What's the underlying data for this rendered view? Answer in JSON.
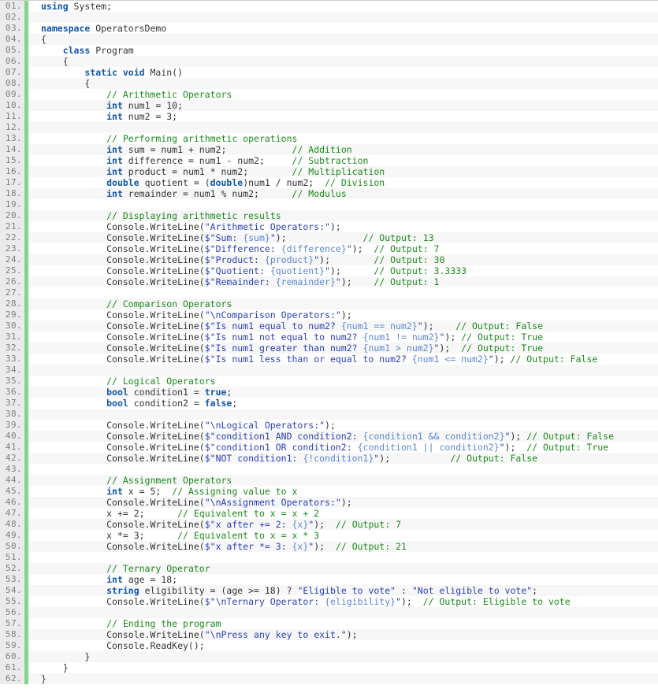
{
  "editor": {
    "language": "csharp",
    "total_lines": 62,
    "colors": {
      "keyword": "#1155aa",
      "comment": "#1a8a1a",
      "string": "#2a3fb8",
      "interpolation": "#5b86d6",
      "plain": "#333333",
      "gutter_bg": "#ebebeb",
      "gutter_text": "#808080",
      "gutter_bar": "#85d48a",
      "row_bg": "#ffffff",
      "row_alt_bg": "#f7f7f7"
    }
  },
  "lines": [
    {
      "n": "01.",
      "tokens": [
        {
          "t": "using",
          "c": "kw"
        },
        {
          "t": " System;",
          "c": "pl"
        }
      ]
    },
    {
      "n": "02.",
      "tokens": []
    },
    {
      "n": "03.",
      "tokens": [
        {
          "t": "namespace",
          "c": "kw"
        },
        {
          "t": " OperatorsDemo",
          "c": "pl"
        }
      ]
    },
    {
      "n": "04.",
      "tokens": [
        {
          "t": "{",
          "c": "pl"
        }
      ]
    },
    {
      "n": "05.",
      "tokens": [
        {
          "t": "    ",
          "c": "pl"
        },
        {
          "t": "class",
          "c": "kw"
        },
        {
          "t": " Program",
          "c": "pl"
        }
      ]
    },
    {
      "n": "06.",
      "tokens": [
        {
          "t": "    {",
          "c": "pl"
        }
      ]
    },
    {
      "n": "07.",
      "tokens": [
        {
          "t": "        ",
          "c": "pl"
        },
        {
          "t": "static",
          "c": "kw"
        },
        {
          "t": " ",
          "c": "pl"
        },
        {
          "t": "void",
          "c": "kw"
        },
        {
          "t": " Main()",
          "c": "pl"
        }
      ]
    },
    {
      "n": "08.",
      "tokens": [
        {
          "t": "        {",
          "c": "pl"
        }
      ]
    },
    {
      "n": "09.",
      "tokens": [
        {
          "t": "            ",
          "c": "pl"
        },
        {
          "t": "// Arithmetic Operators",
          "c": "cmt"
        }
      ]
    },
    {
      "n": "10.",
      "tokens": [
        {
          "t": "            ",
          "c": "pl"
        },
        {
          "t": "int",
          "c": "kw"
        },
        {
          "t": " num1 = 10;",
          "c": "pl"
        }
      ]
    },
    {
      "n": "11.",
      "tokens": [
        {
          "t": "            ",
          "c": "pl"
        },
        {
          "t": "int",
          "c": "kw"
        },
        {
          "t": " num2 = 3;",
          "c": "pl"
        }
      ]
    },
    {
      "n": "12.",
      "tokens": []
    },
    {
      "n": "13.",
      "tokens": [
        {
          "t": "            ",
          "c": "pl"
        },
        {
          "t": "// Performing arithmetic operations",
          "c": "cmt"
        }
      ]
    },
    {
      "n": "14.",
      "tokens": [
        {
          "t": "            ",
          "c": "pl"
        },
        {
          "t": "int",
          "c": "kw"
        },
        {
          "t": " sum = num1 + num2;            ",
          "c": "pl"
        },
        {
          "t": "// Addition",
          "c": "cmt"
        }
      ]
    },
    {
      "n": "15.",
      "tokens": [
        {
          "t": "            ",
          "c": "pl"
        },
        {
          "t": "int",
          "c": "kw"
        },
        {
          "t": " difference = num1 - num2;     ",
          "c": "pl"
        },
        {
          "t": "// Subtraction",
          "c": "cmt"
        }
      ]
    },
    {
      "n": "16.",
      "tokens": [
        {
          "t": "            ",
          "c": "pl"
        },
        {
          "t": "int",
          "c": "kw"
        },
        {
          "t": " product = num1 * num2;        ",
          "c": "pl"
        },
        {
          "t": "// Multiplication",
          "c": "cmt"
        }
      ]
    },
    {
      "n": "17.",
      "tokens": [
        {
          "t": "            ",
          "c": "pl"
        },
        {
          "t": "double",
          "c": "kw"
        },
        {
          "t": " quotient = (",
          "c": "pl"
        },
        {
          "t": "double",
          "c": "kw"
        },
        {
          "t": ")num1 / num2;  ",
          "c": "pl"
        },
        {
          "t": "// Division",
          "c": "cmt"
        }
      ]
    },
    {
      "n": "18.",
      "tokens": [
        {
          "t": "            ",
          "c": "pl"
        },
        {
          "t": "int",
          "c": "kw"
        },
        {
          "t": " remainder = num1 % num2;      ",
          "c": "pl"
        },
        {
          "t": "// Modulus",
          "c": "cmt"
        }
      ]
    },
    {
      "n": "19.",
      "tokens": []
    },
    {
      "n": "20.",
      "tokens": [
        {
          "t": "            ",
          "c": "pl"
        },
        {
          "t": "// Displaying arithmetic results",
          "c": "cmt"
        }
      ]
    },
    {
      "n": "21.",
      "tokens": [
        {
          "t": "            Console.WriteLine(",
          "c": "pl"
        },
        {
          "t": "\"Arithmetic Operators:\"",
          "c": "str"
        },
        {
          "t": ");",
          "c": "pl"
        }
      ]
    },
    {
      "n": "22.",
      "tokens": [
        {
          "t": "            Console.WriteLine(",
          "c": "pl"
        },
        {
          "t": "$\"Sum: ",
          "c": "str"
        },
        {
          "t": "{sum}",
          "c": "hole"
        },
        {
          "t": "\"",
          "c": "str"
        },
        {
          "t": ");              ",
          "c": "pl"
        },
        {
          "t": "// Output: 13",
          "c": "cmt"
        }
      ]
    },
    {
      "n": "23.",
      "tokens": [
        {
          "t": "            Console.WriteLine(",
          "c": "pl"
        },
        {
          "t": "$\"Difference: ",
          "c": "str"
        },
        {
          "t": "{difference}",
          "c": "hole"
        },
        {
          "t": "\"",
          "c": "str"
        },
        {
          "t": ");  ",
          "c": "pl"
        },
        {
          "t": "// Output: 7",
          "c": "cmt"
        }
      ]
    },
    {
      "n": "24.",
      "tokens": [
        {
          "t": "            Console.WriteLine(",
          "c": "pl"
        },
        {
          "t": "$\"Product: ",
          "c": "str"
        },
        {
          "t": "{product}",
          "c": "hole"
        },
        {
          "t": "\"",
          "c": "str"
        },
        {
          "t": ");        ",
          "c": "pl"
        },
        {
          "t": "// Output: 30",
          "c": "cmt"
        }
      ]
    },
    {
      "n": "25.",
      "tokens": [
        {
          "t": "            Console.WriteLine(",
          "c": "pl"
        },
        {
          "t": "$\"Quotient: ",
          "c": "str"
        },
        {
          "t": "{quotient}",
          "c": "hole"
        },
        {
          "t": "\"",
          "c": "str"
        },
        {
          "t": ");      ",
          "c": "pl"
        },
        {
          "t": "// Output: 3.3333",
          "c": "cmt"
        }
      ]
    },
    {
      "n": "26.",
      "tokens": [
        {
          "t": "            Console.WriteLine(",
          "c": "pl"
        },
        {
          "t": "$\"Remainder: ",
          "c": "str"
        },
        {
          "t": "{remainder}",
          "c": "hole"
        },
        {
          "t": "\"",
          "c": "str"
        },
        {
          "t": ");    ",
          "c": "pl"
        },
        {
          "t": "// Output: 1",
          "c": "cmt"
        }
      ]
    },
    {
      "n": "27.",
      "tokens": []
    },
    {
      "n": "28.",
      "tokens": [
        {
          "t": "            ",
          "c": "pl"
        },
        {
          "t": "// Comparison Operators",
          "c": "cmt"
        }
      ]
    },
    {
      "n": "29.",
      "tokens": [
        {
          "t": "            Console.WriteLine(",
          "c": "pl"
        },
        {
          "t": "\"\\nComparison Operators:\"",
          "c": "str"
        },
        {
          "t": ");",
          "c": "pl"
        }
      ]
    },
    {
      "n": "30.",
      "tokens": [
        {
          "t": "            Console.WriteLine(",
          "c": "pl"
        },
        {
          "t": "$\"Is num1 equal to num2? ",
          "c": "str"
        },
        {
          "t": "{num1 == num2}",
          "c": "hole"
        },
        {
          "t": "\"",
          "c": "str"
        },
        {
          "t": ");    ",
          "c": "pl"
        },
        {
          "t": "// Output: False",
          "c": "cmt"
        }
      ]
    },
    {
      "n": "31.",
      "tokens": [
        {
          "t": "            Console.WriteLine(",
          "c": "pl"
        },
        {
          "t": "$\"Is num1 not equal to num2? ",
          "c": "str"
        },
        {
          "t": "{num1 != num2}",
          "c": "hole"
        },
        {
          "t": "\"",
          "c": "str"
        },
        {
          "t": "); ",
          "c": "pl"
        },
        {
          "t": "// Output: True",
          "c": "cmt"
        }
      ]
    },
    {
      "n": "32.",
      "tokens": [
        {
          "t": "            Console.WriteLine(",
          "c": "pl"
        },
        {
          "t": "$\"Is num1 greater than num2? ",
          "c": "str"
        },
        {
          "t": "{num1 > num2}",
          "c": "hole"
        },
        {
          "t": "\"",
          "c": "str"
        },
        {
          "t": ");  ",
          "c": "pl"
        },
        {
          "t": "// Output: True",
          "c": "cmt"
        }
      ]
    },
    {
      "n": "33.",
      "tokens": [
        {
          "t": "            Console.WriteLine(",
          "c": "pl"
        },
        {
          "t": "$\"Is num1 less than or equal to num2? ",
          "c": "str"
        },
        {
          "t": "{num1 <= num2}",
          "c": "hole"
        },
        {
          "t": "\"",
          "c": "str"
        },
        {
          "t": "); ",
          "c": "pl"
        },
        {
          "t": "// Output: False",
          "c": "cmt"
        }
      ]
    },
    {
      "n": "34.",
      "tokens": []
    },
    {
      "n": "35.",
      "tokens": [
        {
          "t": "            ",
          "c": "pl"
        },
        {
          "t": "// Logical Operators",
          "c": "cmt"
        }
      ]
    },
    {
      "n": "36.",
      "tokens": [
        {
          "t": "            ",
          "c": "pl"
        },
        {
          "t": "bool",
          "c": "kw"
        },
        {
          "t": " condition1 = ",
          "c": "pl"
        },
        {
          "t": "true",
          "c": "kw"
        },
        {
          "t": ";",
          "c": "pl"
        }
      ]
    },
    {
      "n": "37.",
      "tokens": [
        {
          "t": "            ",
          "c": "pl"
        },
        {
          "t": "bool",
          "c": "kw"
        },
        {
          "t": " condition2 = ",
          "c": "pl"
        },
        {
          "t": "false",
          "c": "kw"
        },
        {
          "t": ";",
          "c": "pl"
        }
      ]
    },
    {
      "n": "38.",
      "tokens": []
    },
    {
      "n": "39.",
      "tokens": [
        {
          "t": "            Console.WriteLine(",
          "c": "pl"
        },
        {
          "t": "\"\\nLogical Operators:\"",
          "c": "str"
        },
        {
          "t": ");",
          "c": "pl"
        }
      ]
    },
    {
      "n": "40.",
      "tokens": [
        {
          "t": "            Console.WriteLine(",
          "c": "pl"
        },
        {
          "t": "$\"condition1 AND condition2: ",
          "c": "str"
        },
        {
          "t": "{condition1 && condition2}",
          "c": "hole"
        },
        {
          "t": "\"",
          "c": "str"
        },
        {
          "t": "); ",
          "c": "pl"
        },
        {
          "t": "// Output: False",
          "c": "cmt"
        }
      ]
    },
    {
      "n": "41.",
      "tokens": [
        {
          "t": "            Console.WriteLine(",
          "c": "pl"
        },
        {
          "t": "$\"condition1 OR condition2: ",
          "c": "str"
        },
        {
          "t": "{condition1 || condition2}",
          "c": "hole"
        },
        {
          "t": "\"",
          "c": "str"
        },
        {
          "t": ");  ",
          "c": "pl"
        },
        {
          "t": "// Output: True",
          "c": "cmt"
        }
      ]
    },
    {
      "n": "42.",
      "tokens": [
        {
          "t": "            Console.WriteLine(",
          "c": "pl"
        },
        {
          "t": "$\"NOT condition1: ",
          "c": "str"
        },
        {
          "t": "{!condition1}",
          "c": "hole"
        },
        {
          "t": "\"",
          "c": "str"
        },
        {
          "t": ");           ",
          "c": "pl"
        },
        {
          "t": "// Output: False",
          "c": "cmt"
        }
      ]
    },
    {
      "n": "43.",
      "tokens": []
    },
    {
      "n": "44.",
      "tokens": [
        {
          "t": "            ",
          "c": "pl"
        },
        {
          "t": "// Assignment Operators",
          "c": "cmt"
        }
      ]
    },
    {
      "n": "45.",
      "tokens": [
        {
          "t": "            ",
          "c": "pl"
        },
        {
          "t": "int",
          "c": "kw"
        },
        {
          "t": " x = 5;  ",
          "c": "pl"
        },
        {
          "t": "// Assigning value to x",
          "c": "cmt"
        }
      ]
    },
    {
      "n": "46.",
      "tokens": [
        {
          "t": "            Console.WriteLine(",
          "c": "pl"
        },
        {
          "t": "\"\\nAssignment Operators:\"",
          "c": "str"
        },
        {
          "t": ");",
          "c": "pl"
        }
      ]
    },
    {
      "n": "47.",
      "tokens": [
        {
          "t": "            x += 2;      ",
          "c": "pl"
        },
        {
          "t": "// Equivalent to x = x + 2",
          "c": "cmt"
        }
      ]
    },
    {
      "n": "48.",
      "tokens": [
        {
          "t": "            Console.WriteLine(",
          "c": "pl"
        },
        {
          "t": "$\"x after += 2: ",
          "c": "str"
        },
        {
          "t": "{x}",
          "c": "hole"
        },
        {
          "t": "\"",
          "c": "str"
        },
        {
          "t": ");  ",
          "c": "pl"
        },
        {
          "t": "// Output: 7",
          "c": "cmt"
        }
      ]
    },
    {
      "n": "49.",
      "tokens": [
        {
          "t": "            x *= 3;      ",
          "c": "pl"
        },
        {
          "t": "// Equivalent to x = x * 3",
          "c": "cmt"
        }
      ]
    },
    {
      "n": "50.",
      "tokens": [
        {
          "t": "            Console.WriteLine(",
          "c": "pl"
        },
        {
          "t": "$\"x after *= 3: ",
          "c": "str"
        },
        {
          "t": "{x}",
          "c": "hole"
        },
        {
          "t": "\"",
          "c": "str"
        },
        {
          "t": ");  ",
          "c": "pl"
        },
        {
          "t": "// Output: 21",
          "c": "cmt"
        }
      ]
    },
    {
      "n": "51.",
      "tokens": []
    },
    {
      "n": "52.",
      "tokens": [
        {
          "t": "            ",
          "c": "pl"
        },
        {
          "t": "// Ternary Operator",
          "c": "cmt"
        }
      ]
    },
    {
      "n": "53.",
      "tokens": [
        {
          "t": "            ",
          "c": "pl"
        },
        {
          "t": "int",
          "c": "kw"
        },
        {
          "t": " age = 18;",
          "c": "pl"
        }
      ]
    },
    {
      "n": "54.",
      "tokens": [
        {
          "t": "            ",
          "c": "pl"
        },
        {
          "t": "string",
          "c": "kw"
        },
        {
          "t": " eligibility = (age >= 18) ? ",
          "c": "pl"
        },
        {
          "t": "\"Eligible to vote\"",
          "c": "str"
        },
        {
          "t": " : ",
          "c": "pl"
        },
        {
          "t": "\"Not eligible to vote\"",
          "c": "str"
        },
        {
          "t": ";",
          "c": "pl"
        }
      ]
    },
    {
      "n": "55.",
      "tokens": [
        {
          "t": "            Console.WriteLine(",
          "c": "pl"
        },
        {
          "t": "$\"\\nTernary Operator: ",
          "c": "str"
        },
        {
          "t": "{eligibility}",
          "c": "hole"
        },
        {
          "t": "\"",
          "c": "str"
        },
        {
          "t": ");  ",
          "c": "pl"
        },
        {
          "t": "// Output: Eligible to vote",
          "c": "cmt"
        }
      ]
    },
    {
      "n": "56.",
      "tokens": []
    },
    {
      "n": "57.",
      "tokens": [
        {
          "t": "            ",
          "c": "pl"
        },
        {
          "t": "// Ending the program",
          "c": "cmt"
        }
      ]
    },
    {
      "n": "58.",
      "tokens": [
        {
          "t": "            Console.WriteLine(",
          "c": "pl"
        },
        {
          "t": "\"\\nPress any key to exit.\"",
          "c": "str"
        },
        {
          "t": ");",
          "c": "pl"
        }
      ]
    },
    {
      "n": "59.",
      "tokens": [
        {
          "t": "            Console.ReadKey();",
          "c": "pl"
        }
      ]
    },
    {
      "n": "60.",
      "tokens": [
        {
          "t": "        }",
          "c": "pl"
        }
      ]
    },
    {
      "n": "61.",
      "tokens": [
        {
          "t": "    }",
          "c": "pl"
        }
      ]
    },
    {
      "n": "62.",
      "tokens": [
        {
          "t": "}",
          "c": "pl"
        }
      ]
    }
  ]
}
